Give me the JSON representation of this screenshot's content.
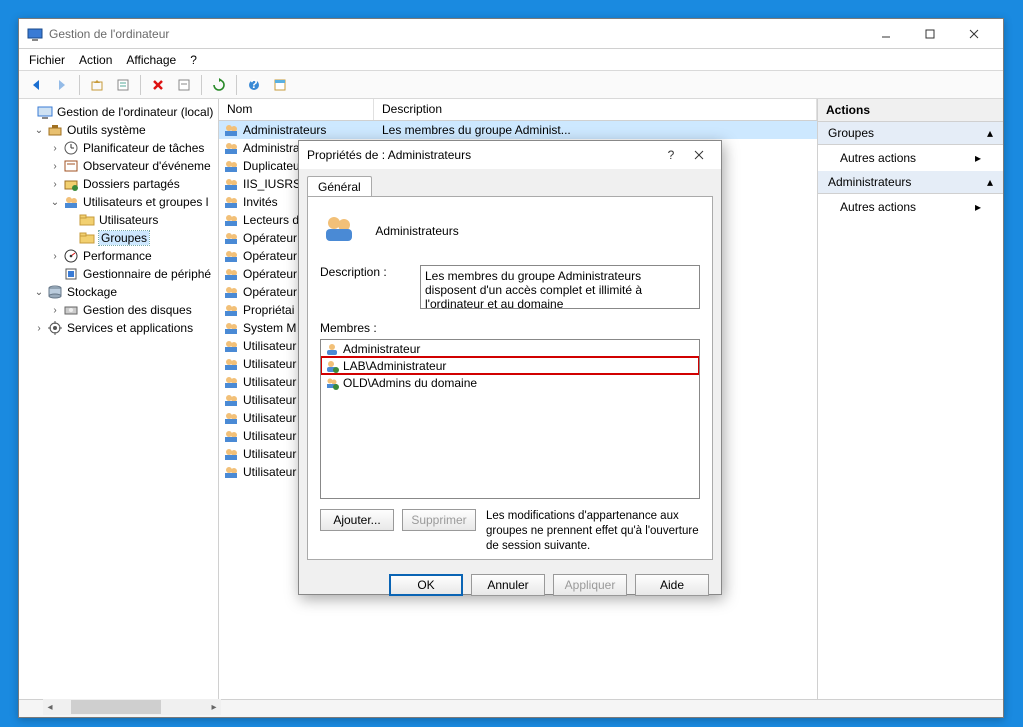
{
  "window": {
    "title": "Gestion de l'ordinateur",
    "menu": [
      "Fichier",
      "Action",
      "Affichage",
      "?"
    ]
  },
  "tree": [
    {
      "indent": 0,
      "exp": "",
      "icon": "computer",
      "label": "Gestion de l'ordinateur (local)"
    },
    {
      "indent": 1,
      "exp": "v",
      "icon": "tools",
      "label": "Outils système"
    },
    {
      "indent": 2,
      "exp": ">",
      "icon": "clock",
      "label": "Planificateur de tâches"
    },
    {
      "indent": 2,
      "exp": ">",
      "icon": "event",
      "label": "Observateur d'événeme"
    },
    {
      "indent": 2,
      "exp": ">",
      "icon": "share",
      "label": "Dossiers partagés"
    },
    {
      "indent": 2,
      "exp": "v",
      "icon": "usersgrp",
      "label": "Utilisateurs et groupes l"
    },
    {
      "indent": 3,
      "exp": "",
      "icon": "folder",
      "label": "Utilisateurs"
    },
    {
      "indent": 3,
      "exp": "",
      "icon": "folder",
      "label": "Groupes",
      "selected": true
    },
    {
      "indent": 2,
      "exp": ">",
      "icon": "perf",
      "label": "Performance"
    },
    {
      "indent": 2,
      "exp": "",
      "icon": "device",
      "label": "Gestionnaire de périphé"
    },
    {
      "indent": 1,
      "exp": "v",
      "icon": "storage",
      "label": "Stockage"
    },
    {
      "indent": 2,
      "exp": ">",
      "icon": "disk",
      "label": "Gestion des disques"
    },
    {
      "indent": 1,
      "exp": ">",
      "icon": "services",
      "label": "Services et applications"
    }
  ],
  "list": {
    "headers": {
      "name": "Nom",
      "desc": "Description"
    },
    "rows": [
      {
        "name": "Administrateurs",
        "desc": "Les membres du groupe Administ...",
        "selected": true
      },
      {
        "name": "Administrat",
        "desc": ""
      },
      {
        "name": "Duplicateu",
        "desc": ""
      },
      {
        "name": "IIS_IUSRS",
        "desc": ""
      },
      {
        "name": "Invités",
        "desc": ""
      },
      {
        "name": "Lecteurs d",
        "desc": ""
      },
      {
        "name": "Opérateur",
        "desc": ""
      },
      {
        "name": "Opérateur",
        "desc": ""
      },
      {
        "name": "Opérateur",
        "desc": ""
      },
      {
        "name": "Opérateur",
        "desc": ""
      },
      {
        "name": "Propriétai",
        "desc": ""
      },
      {
        "name": "System M",
        "desc": ""
      },
      {
        "name": "Utilisateur",
        "desc": ""
      },
      {
        "name": "Utilisateur",
        "desc": ""
      },
      {
        "name": "Utilisateur",
        "desc": ""
      },
      {
        "name": "Utilisateur",
        "desc": ""
      },
      {
        "name": "Utilisateur",
        "desc": ""
      },
      {
        "name": "Utilisateur",
        "desc": ""
      },
      {
        "name": "Utilisateur",
        "desc": ""
      },
      {
        "name": "Utilisateur",
        "desc": ""
      }
    ]
  },
  "actions": {
    "header": "Actions",
    "sections": [
      {
        "title": "Groupes",
        "items": [
          "Autres actions"
        ]
      },
      {
        "title": "Administrateurs",
        "items": [
          "Autres actions"
        ]
      }
    ]
  },
  "dialog": {
    "title": "Propriétés de : Administrateurs",
    "tab": "Général",
    "group_name": "Administrateurs",
    "desc_label": "Description :",
    "desc_text": "Les membres du groupe Administrateurs disposent d'un accès complet et illimité à l'ordinateur et au domaine",
    "members_label": "Membres :",
    "members": [
      {
        "icon": "user",
        "label": "Administrateur",
        "hl": false
      },
      {
        "icon": "netuser",
        "label": "LAB\\Administrateur",
        "hl": true
      },
      {
        "icon": "netgrp",
        "label": "OLD\\Admins du domaine",
        "hl": false
      }
    ],
    "note": "Les modifications d'appartenance aux groupes ne prennent effet qu'à l'ouverture de session suivante.",
    "buttons": {
      "add": "Ajouter...",
      "remove": "Supprimer",
      "ok": "OK",
      "cancel": "Annuler",
      "apply": "Appliquer",
      "help": "Aide"
    }
  }
}
